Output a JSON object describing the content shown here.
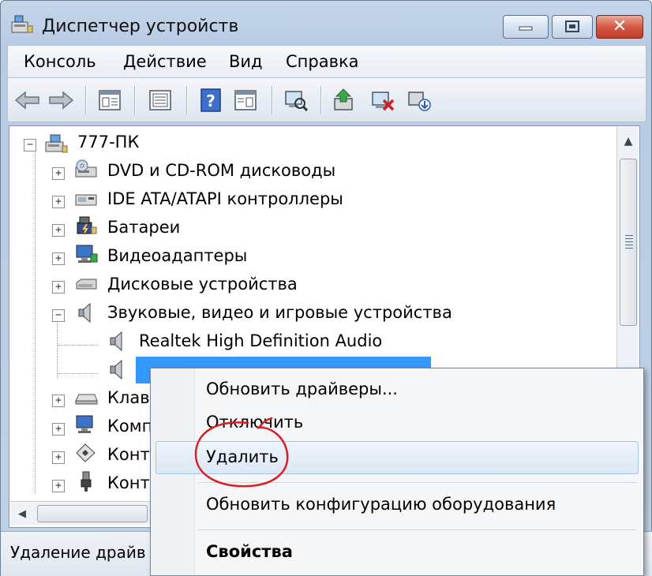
{
  "window": {
    "title": "Диспетчер устройств"
  },
  "menubar": {
    "items": [
      "Консоль",
      "Действие",
      "Вид",
      "Справка"
    ]
  },
  "toolbar": {
    "buttons": [
      "back-arrow-icon",
      "forward-arrow-icon",
      "properties-icon",
      "console-icon",
      "help-icon",
      "view-icon",
      "scan-hardware-icon",
      "update-driver-icon",
      "uninstall-icon",
      "disable-icon"
    ]
  },
  "tree": {
    "root": "777-ПК",
    "items": [
      {
        "label": "DVD и CD-ROM дисководы",
        "icon": "dvd-drive-icon",
        "expanded": false
      },
      {
        "label": "IDE ATA/ATAPI контроллеры",
        "icon": "ide-controller-icon",
        "expanded": false
      },
      {
        "label": "Батареи",
        "icon": "battery-icon",
        "expanded": false
      },
      {
        "label": "Видеоадаптеры",
        "icon": "display-adapter-icon",
        "expanded": false
      },
      {
        "label": "Дисковые устройства",
        "icon": "disk-drive-icon",
        "expanded": false
      },
      {
        "label": "Звуковые, видео и игровые устройства",
        "icon": "speaker-icon",
        "expanded": true
      },
      {
        "label": "Клав",
        "icon": "keyboard-icon",
        "expanded": false
      },
      {
        "label": "Комп",
        "icon": "computer-icon",
        "expanded": false
      },
      {
        "label": "Конт",
        "icon": "controller-icon",
        "expanded": false
      },
      {
        "label": "Конт",
        "icon": "usb-icon",
        "expanded": false
      }
    ],
    "children": [
      {
        "label": "Realtek High Definition Audio",
        "icon": "speaker-icon",
        "selected": false
      },
      {
        "label": "",
        "icon": "speaker-icon",
        "selected": true
      }
    ]
  },
  "context_menu": {
    "items": [
      {
        "label": "Обновить драйверы...",
        "bold": false
      },
      {
        "label": "Отключить",
        "bold": false
      },
      {
        "label": "Удалить",
        "bold": false,
        "hovered": true
      },
      {
        "label": "Обновить конфигурацию оборудования",
        "bold": false
      },
      {
        "label": "Свойства",
        "bold": true
      }
    ],
    "highlight_color": "#d81f26"
  },
  "statusbar": {
    "text": "Удаление драйв"
  },
  "colors": {
    "selection": "#3399ff",
    "titlebar": "#c5d6ea",
    "close_button": "#c13c25"
  }
}
